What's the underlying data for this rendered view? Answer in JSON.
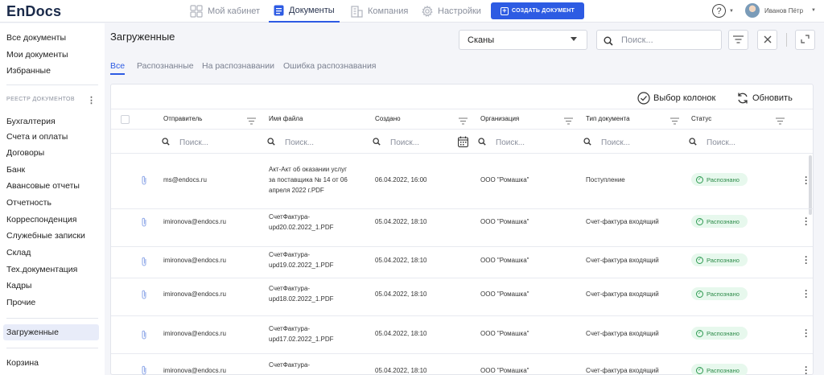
{
  "app": {
    "logo": "EnDocs"
  },
  "topnav": {
    "items": [
      {
        "label": "Мой кабинет",
        "icon": "grid-icon",
        "active": false
      },
      {
        "label": "Документы",
        "icon": "document-icon",
        "active": true
      },
      {
        "label": "Компания",
        "icon": "building-icon",
        "active": false
      },
      {
        "label": "Настройки",
        "icon": "gear-icon",
        "active": false
      }
    ],
    "create_label": "СОЗДАТЬ ДОКУМЕНТ",
    "help_label": "?",
    "user_name": "Иванов Пётр"
  },
  "sidebar": {
    "top_items": [
      "Все документы",
      "Мои документы",
      "Избранные"
    ],
    "section_title": "РЕЕСТР ДОКУМЕНТОВ",
    "registry_items": [
      "Бухгалтерия",
      "Счета и оплаты",
      "Договоры",
      "Банк",
      "Авансовые отчеты",
      "Отчетность",
      "Корреспонденция",
      "Служебные записки",
      "Склад",
      "Тех.документация",
      "Кадры",
      "Прочие"
    ],
    "active_item": "Загруженные",
    "trash_item": "Корзина"
  },
  "main": {
    "title": "Загруженные",
    "select_value": "Сканы",
    "search_placeholder": "Поиск...",
    "tabs": [
      {
        "label": "Все",
        "active": true
      },
      {
        "label": "Распознанные",
        "active": false
      },
      {
        "label": "На распознавании",
        "active": false
      },
      {
        "label": "Ошибка распознавания",
        "active": false
      }
    ]
  },
  "table": {
    "columns_button": "Выбор колонок",
    "refresh_button": "Обновить",
    "columns": [
      "Отправитель",
      "Имя файла",
      "Создано",
      "Организация",
      "Тип документа",
      "Статус"
    ],
    "filter_placeholder": "Поиск...",
    "rows": [
      {
        "sender": "ms@endocs.ru",
        "file": [
          "Акт-Акт об оказании услуг",
          "за поставщика № 14 от 06",
          "апреля 2022 г.PDF"
        ],
        "created": "06.04.2022, 16:00",
        "org": "ООО \"Ромашка\"",
        "type": "Поступление",
        "status": "Распознано"
      },
      {
        "sender": "imironova@endocs.ru",
        "file": [
          "СчетФактура-",
          "upd20.02.2022_1.PDF"
        ],
        "created": "05.04.2022, 18:10",
        "org": "ООО \"Ромашка\"",
        "type": "Счет-фактура входящий",
        "status": "Распознано"
      },
      {
        "sender": "imironova@endocs.ru",
        "file": [
          "СчетФактура-",
          "upd19.02.2022_1.PDF"
        ],
        "created": "05.04.2022, 18:10",
        "org": "ООО \"Ромашка\"",
        "type": "Счет-фактура входящий",
        "status": "Распознано"
      },
      {
        "sender": "imironova@endocs.ru",
        "file": [
          "СчетФактура-",
          "upd18.02.2022_1.PDF"
        ],
        "created": "05.04.2022, 18:10",
        "org": "ООО \"Ромашка\"",
        "type": "Счет-фактура входящий",
        "status": "Распознано"
      },
      {
        "sender": "imironova@endocs.ru",
        "file": [
          "СчетФактура-",
          "upd17.02.2022_1.PDF"
        ],
        "created": "05.04.2022, 18:10",
        "org": "ООО \"Ромашка\"",
        "type": "Счет-фактура входящий",
        "status": "Распознано"
      },
      {
        "sender": "imironova@endocs.ru",
        "file": [
          "СчетФактура-"
        ],
        "created": "05.04.2022, 18:10",
        "org": "ООО \"Ромашка\"",
        "type": "Счет-фактура входящий",
        "status": "Распознано"
      }
    ]
  },
  "colors": {
    "accent": "#2d5be3",
    "status_ok": "#2c8a48",
    "status_bg": "#e7f8ed"
  }
}
